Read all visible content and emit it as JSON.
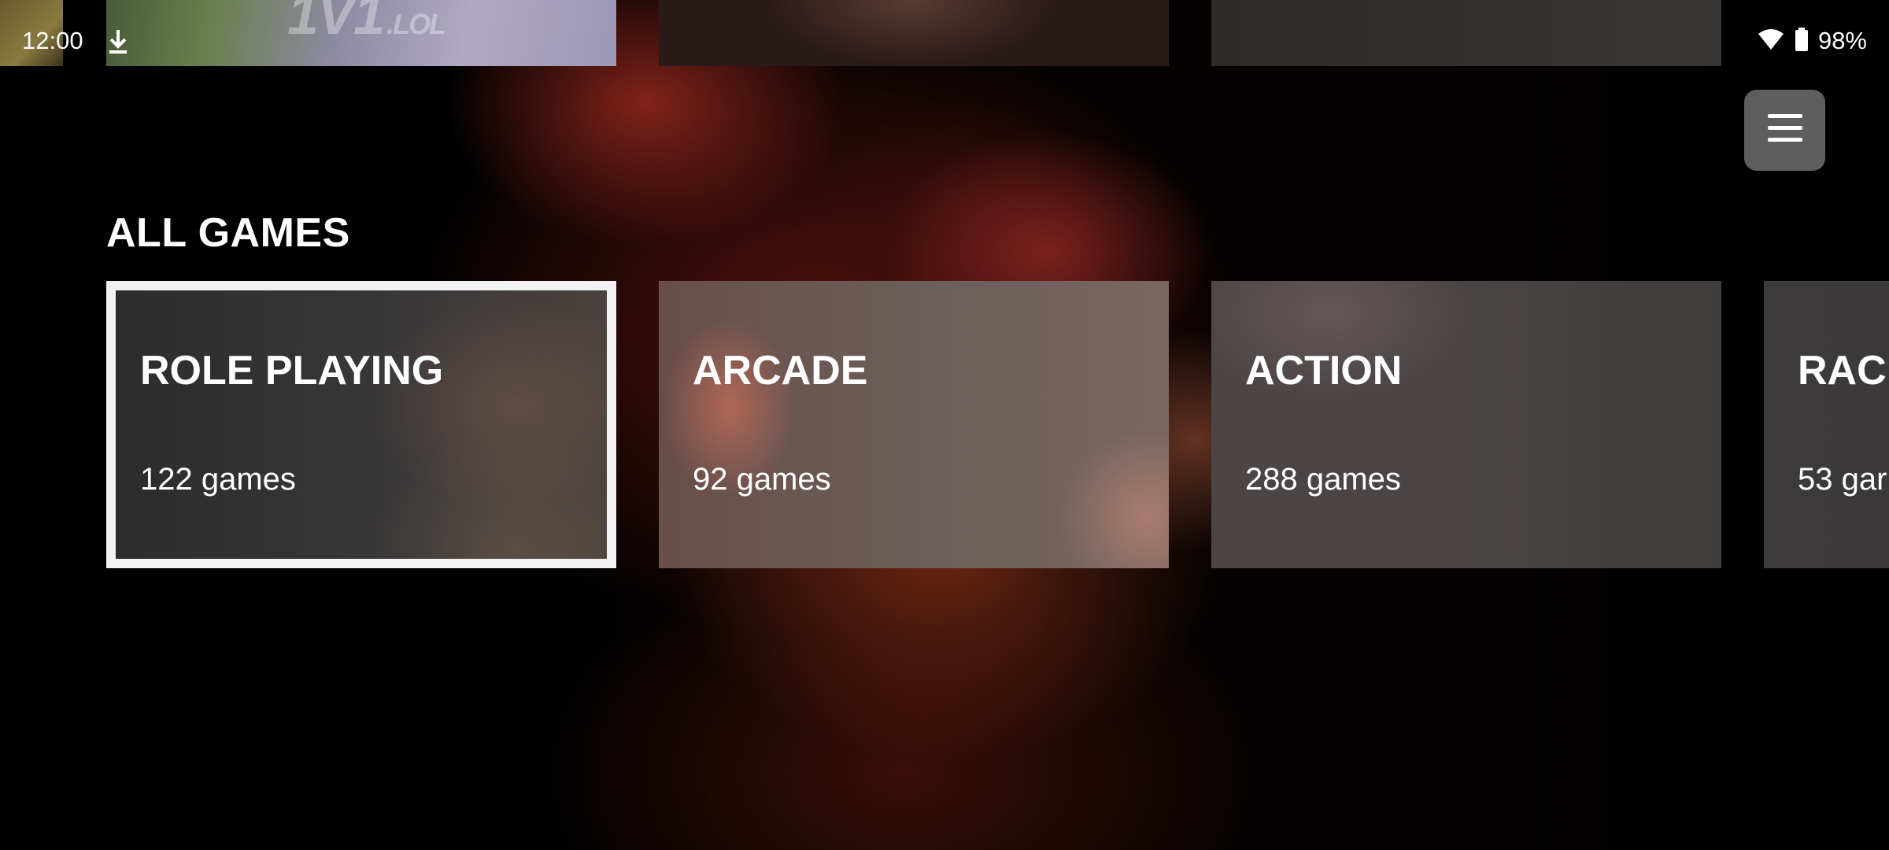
{
  "status_bar": {
    "time": "12:00",
    "battery": "98%",
    "icons": [
      "download-icon",
      "wifi-icon",
      "battery-icon"
    ]
  },
  "top_carousel": {
    "tiles": [
      {
        "art_text": ""
      },
      {
        "art_text": "1V1",
        "art_suffix": ".LOL"
      },
      {
        "art_text": ""
      },
      {
        "art_text": ""
      }
    ]
  },
  "menu": {
    "icon": "hamburger-menu-icon"
  },
  "all_games": {
    "title": "ALL GAMES",
    "categories": [
      {
        "name": "ROLE PLAYING",
        "count": "122 games",
        "selected": true
      },
      {
        "name": "ARCADE",
        "count": "92 games",
        "selected": false
      },
      {
        "name": "ACTION",
        "count": "288 games",
        "selected": false
      },
      {
        "name": "RACI",
        "count": "53 gar",
        "selected": false
      }
    ]
  },
  "colors": {
    "background": "#000000",
    "focus_outline": "#f2f2f2",
    "menu_button": "#6e6e6e",
    "text": "#ffffff"
  }
}
